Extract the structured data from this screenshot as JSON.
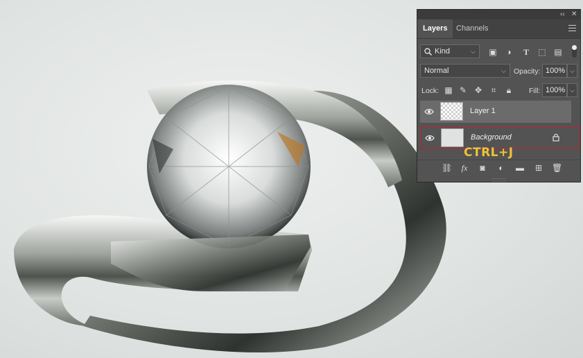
{
  "panel": {
    "title_controls": {
      "collapse": "‹‹",
      "close": "✕"
    },
    "tabs": [
      {
        "label": "Layers",
        "active": true
      },
      {
        "label": "Channels",
        "active": false
      }
    ],
    "filter": {
      "kind_label": "Kind"
    },
    "blend": {
      "mode": "Normal",
      "opacity_label": "Opacity:",
      "opacity_value": "100%"
    },
    "lock": {
      "label": "Lock:",
      "fill_label": "Fill:",
      "fill_value": "100%"
    },
    "layers": [
      {
        "name": "Layer 1",
        "visible": true,
        "selected": true,
        "locked": false
      },
      {
        "name": "Background",
        "visible": true,
        "selected": false,
        "locked": true
      }
    ],
    "annotation": "CTRL+J",
    "colors": {
      "panel": "#535353",
      "selected_layer": "#6b6b6b",
      "highlight_border": "#c2212e",
      "annotation": "#f0c23a"
    }
  },
  "icons": [
    "search-icon",
    "image-filter-icon",
    "adjustment-filter-icon",
    "type-filter-icon",
    "shape-filter-icon",
    "smart-object-filter-icon",
    "filter-toggle-icon",
    "lock-transparent-icon",
    "lock-paint-icon",
    "lock-move-icon",
    "lock-artboard-icon",
    "lock-all-icon",
    "eye-icon",
    "lock-icon",
    "link-icon",
    "fx-icon",
    "mask-icon",
    "adjustment-icon",
    "folder-icon",
    "new-layer-icon",
    "trash-icon"
  ]
}
